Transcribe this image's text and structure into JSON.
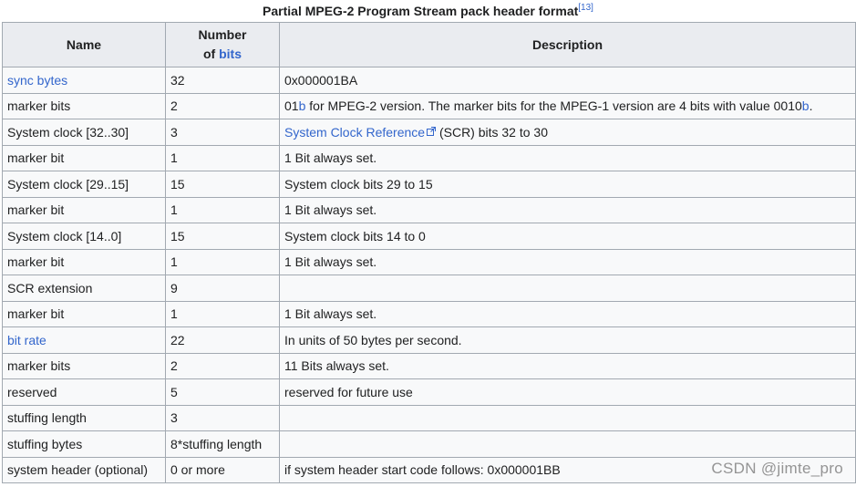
{
  "caption": {
    "text": "Partial MPEG-2 Program Stream pack header format",
    "ref": "[13]"
  },
  "headers": {
    "name": "Name",
    "bits_line1": "Number",
    "bits_of": "of ",
    "bits_link": "bits",
    "description": "Description"
  },
  "rows": [
    {
      "name": "sync bytes",
      "bits": "32",
      "desc": "0x000001BA"
    },
    {
      "name": "marker bits",
      "bits": "2",
      "desc_b1": "01",
      "desc_b1_suffix": "b",
      "desc_mid": " for MPEG-2 version. The marker bits for the MPEG-1 version are 4 bits with value 0010",
      "desc_b2_suffix": "b",
      "desc_end": "."
    },
    {
      "name": "System clock [32..30]",
      "bits": "3",
      "desc_link": "System Clock Reference",
      "desc_rest": " (SCR) bits 32 to 30"
    },
    {
      "name": "marker bit",
      "bits": "1",
      "desc": "1 Bit always set."
    },
    {
      "name": "System clock [29..15]",
      "bits": "15",
      "desc": "System clock bits 29 to 15"
    },
    {
      "name": "marker bit",
      "bits": "1",
      "desc": "1 Bit always set."
    },
    {
      "name": "System clock [14..0]",
      "bits": "15",
      "desc": "System clock bits 14 to 0"
    },
    {
      "name": "marker bit",
      "bits": "1",
      "desc": "1 Bit always set."
    },
    {
      "name": "SCR extension",
      "bits": "9",
      "desc": ""
    },
    {
      "name": "marker bit",
      "bits": "1",
      "desc": "1 Bit always set."
    },
    {
      "name": "bit rate",
      "bits": "22",
      "desc": "In units of 50 bytes per second."
    },
    {
      "name": "marker bits",
      "bits": "2",
      "desc": "11 Bits always set."
    },
    {
      "name": "reserved",
      "bits": "5",
      "desc": "reserved for future use"
    },
    {
      "name": "stuffing length",
      "bits": "3",
      "desc": ""
    },
    {
      "name": "stuffing bytes",
      "bits": "8*stuffing length",
      "desc": ""
    },
    {
      "name": "system header (optional)",
      "bits": "0 or more",
      "desc": "if system header start code follows: 0x000001BB"
    }
  ],
  "watermark": "CSDN @jimte_pro",
  "colors": {
    "link": "#3366cc",
    "border": "#a2a9b1",
    "header_bg": "#eaecf0",
    "cell_bg": "#f8f9fa",
    "text": "#202122"
  },
  "icons": {
    "external_link": "external-link-icon"
  }
}
